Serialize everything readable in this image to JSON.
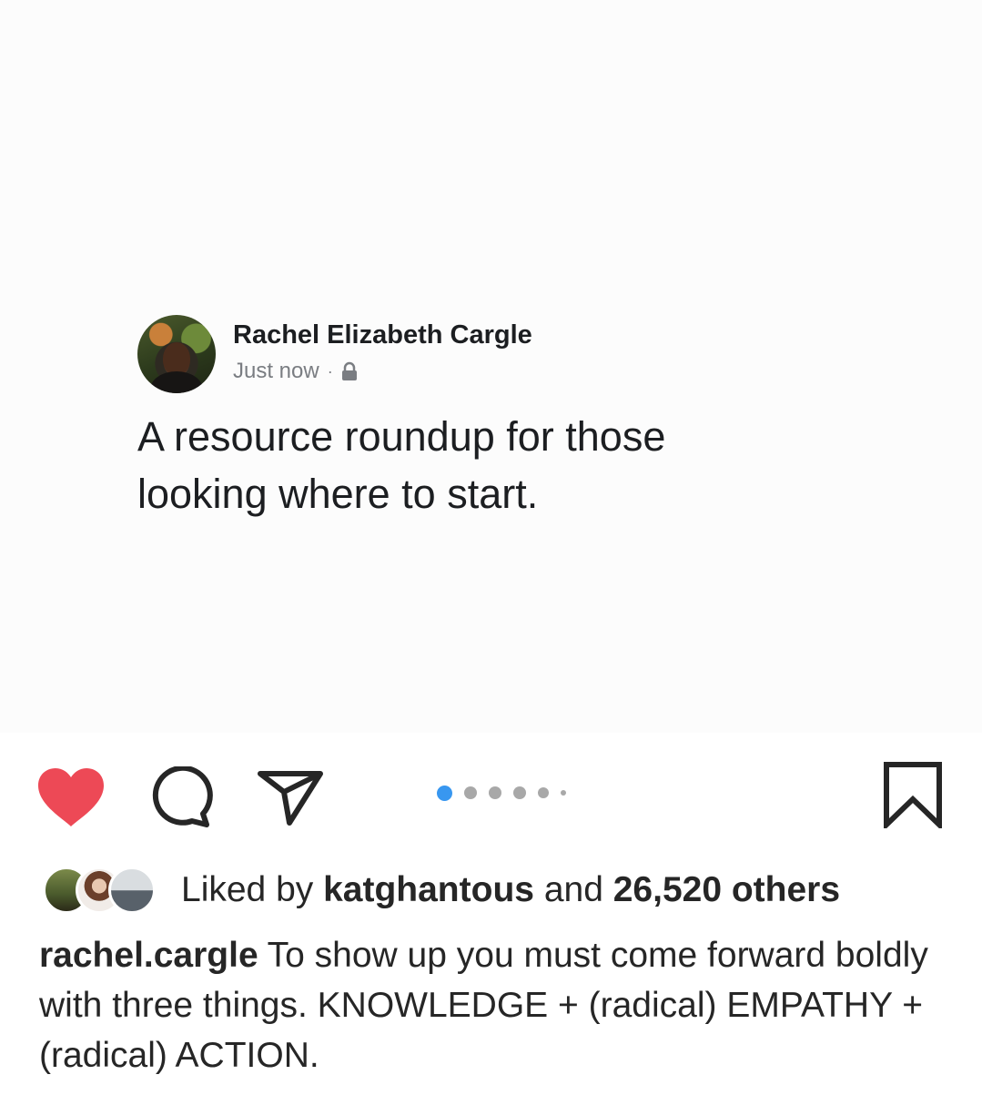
{
  "post": {
    "author_name": "Rachel Elizabeth Cargle",
    "timestamp": "Just now",
    "separator": "·",
    "body": "A resource roundup for those looking where to start."
  },
  "actions": {
    "liked": true,
    "like_color": "#ed4956",
    "icons": [
      "heart-icon",
      "comment-icon",
      "share-icon",
      "bookmark-icon"
    ],
    "carousel_count": 6,
    "carousel_active": 1,
    "carousel_active_color": "#3897f0"
  },
  "likes": {
    "prefix": "Liked by",
    "user": "katghantous",
    "middle": "and",
    "others": "26,520 others"
  },
  "caption": {
    "username": "rachel.cargle",
    "text": "To show up you must come forward boldly with three things. KNOWLEDGE + (radical) EMPATHY + (radical) ACTION."
  }
}
